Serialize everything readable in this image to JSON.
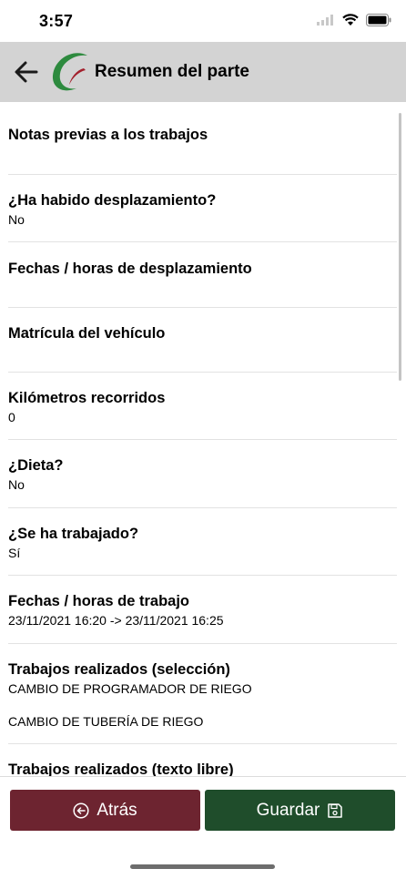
{
  "status_bar": {
    "time": "3:57"
  },
  "header": {
    "title": "Resumen del parte",
    "back_icon": "arrow-left-icon",
    "logo": "company-logo"
  },
  "rows": [
    {
      "title": "Notas previas a los trabajos",
      "value": ""
    },
    {
      "title": "¿Ha habido desplazamiento?",
      "value": "No"
    },
    {
      "title": "Fechas / horas de desplazamiento",
      "value": ""
    },
    {
      "title": "Matrícula del vehículo",
      "value": ""
    },
    {
      "title": "Kilómetros recorridos",
      "value": "0"
    },
    {
      "title": "¿Dieta?",
      "value": "No"
    },
    {
      "title": "¿Se ha trabajado?",
      "value": "Sí"
    },
    {
      "title": "Fechas / horas de trabajo",
      "value": "23/11/2021 16:20 -> 23/11/2021 16:25"
    },
    {
      "title": "Trabajos realizados (selección)",
      "values": [
        "CAMBIO DE PROGRAMADOR DE RIEGO",
        "CAMBIO DE TUBERÍA DE RIEGO"
      ]
    },
    {
      "title": "Trabajos realizados (texto libre)",
      "value": ""
    }
  ],
  "footer": {
    "back_label": "Atrás",
    "save_label": "Guardar",
    "back_color": "#6d2430",
    "save_color": "#1f4d2b"
  },
  "colors": {
    "header_bg": "#d3d3d3",
    "logo_green": "#2d8a3e",
    "logo_red": "#a3202c"
  }
}
